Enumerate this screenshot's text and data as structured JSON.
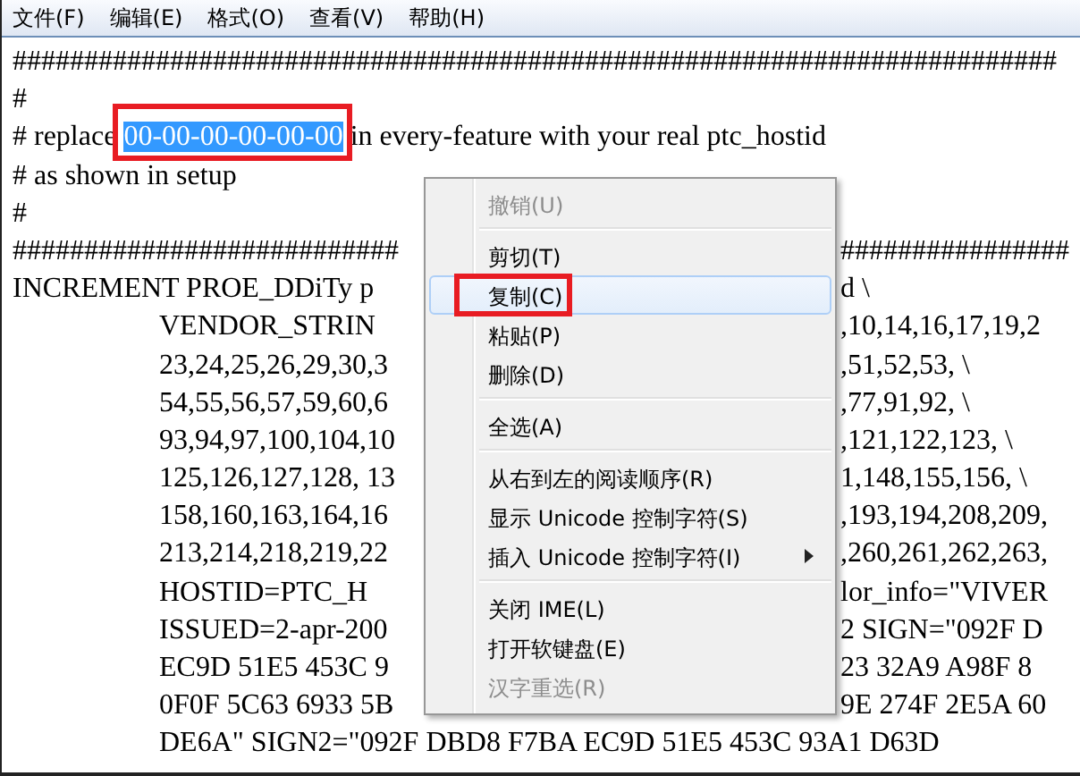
{
  "menubar": [
    {
      "label": "文件(F)"
    },
    {
      "label": "编辑(E)"
    },
    {
      "label": "格式(O)"
    },
    {
      "label": "查看(V)"
    },
    {
      "label": "帮助(H)"
    }
  ],
  "editor": {
    "lines": [
      {
        "indented": false,
        "text": "#########################################################################"
      },
      {
        "indented": false,
        "text": "#"
      },
      {
        "indented": false,
        "text": "# replace ",
        "selection": "00-00-00-00-00-00",
        "selection_boxed": true,
        "after": " in every-feature with your real ptc_hostid"
      },
      {
        "indented": false,
        "text": "# as shown in setup"
      },
      {
        "indented": false,
        "text": "#"
      },
      {
        "indented": false,
        "text": "###########################",
        "right": "################"
      },
      {
        "indented": false,
        "text": "INCREMENT PROE_DDiTy p",
        "right": "d \\"
      },
      {
        "indented": true,
        "text": "VENDOR_STRIN",
        "right": ",10,14,16,17,19,2"
      },
      {
        "indented": true,
        "text": "23,24,25,26,29,30,3",
        "right": ",51,52,53, \\"
      },
      {
        "indented": true,
        "text": "54,55,56,57,59,60,6",
        "right": ",77,91,92, \\"
      },
      {
        "indented": true,
        "text": "93,94,97,100,104,10",
        "right": ",121,122,123, \\"
      },
      {
        "indented": true,
        "text": "125,126,127,128, 13",
        "right": "1,148,155,156, \\"
      },
      {
        "indented": true,
        "text": "158,160,163,164,16",
        "right": ",193,194,208,209,"
      },
      {
        "indented": true,
        "text": "213,214,218,219,22",
        "right": ",260,261,262,263,"
      },
      {
        "indented": true,
        "text": "HOSTID=PTC_H",
        "right": "lor_info=\"VIVER"
      },
      {
        "indented": true,
        "text": "ISSUED=2-apr-200",
        "right": "2 SIGN=\"092F D"
      },
      {
        "indented": true,
        "text": "EC9D 51E5 453C 9",
        "right": "23 32A9 A98F 8"
      },
      {
        "indented": true,
        "text": "0F0F 5C63 6933 5B",
        "right": "9E 274F 2E5A 60"
      },
      {
        "indented": true,
        "text": "DE6A\" SIGN2=\"092F DBD8 F7BA EC9D 51E5 453C 93A1 D63D"
      }
    ]
  },
  "context_menu": {
    "items": [
      {
        "kind": "item",
        "label": "撤销(U)",
        "disabled": true,
        "highlighted": false,
        "boxed": false,
        "submenu": false
      },
      {
        "kind": "separator"
      },
      {
        "kind": "item",
        "label": "剪切(T)",
        "disabled": false,
        "highlighted": false,
        "boxed": false,
        "submenu": false
      },
      {
        "kind": "item",
        "label": "复制(C)",
        "disabled": false,
        "highlighted": true,
        "boxed": true,
        "submenu": false
      },
      {
        "kind": "item",
        "label": "粘贴(P)",
        "disabled": false,
        "highlighted": false,
        "boxed": false,
        "submenu": false
      },
      {
        "kind": "item",
        "label": "删除(D)",
        "disabled": false,
        "highlighted": false,
        "boxed": false,
        "submenu": false
      },
      {
        "kind": "separator"
      },
      {
        "kind": "item",
        "label": "全选(A)",
        "disabled": false,
        "highlighted": false,
        "boxed": false,
        "submenu": false
      },
      {
        "kind": "separator"
      },
      {
        "kind": "item",
        "label": "从右到左的阅读顺序(R)",
        "disabled": false,
        "highlighted": false,
        "boxed": false,
        "submenu": false
      },
      {
        "kind": "item",
        "label": "显示 Unicode 控制字符(S)",
        "disabled": false,
        "highlighted": false,
        "boxed": false,
        "submenu": false
      },
      {
        "kind": "item",
        "label": "插入 Unicode 控制字符(I)",
        "disabled": false,
        "highlighted": false,
        "boxed": false,
        "submenu": true
      },
      {
        "kind": "separator"
      },
      {
        "kind": "item",
        "label": "关闭 IME(L)",
        "disabled": false,
        "highlighted": false,
        "boxed": false,
        "submenu": false
      },
      {
        "kind": "item",
        "label": "打开软键盘(E)",
        "disabled": false,
        "highlighted": false,
        "boxed": false,
        "submenu": false
      },
      {
        "kind": "item",
        "label": "汉字重选(R)",
        "disabled": true,
        "highlighted": false,
        "boxed": false,
        "submenu": false
      }
    ]
  }
}
